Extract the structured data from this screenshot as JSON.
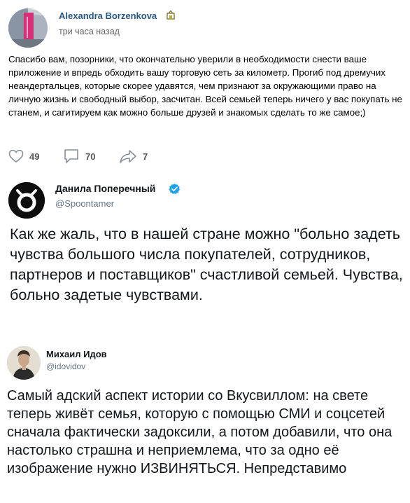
{
  "vk_post": {
    "author": "Alexandra Borzenkova",
    "time": "три часа назад",
    "text": "Спасибо вам, позорники, что окончательно уверили в необходимости снести ваше приложение и впредь обходить вашу торговую сеть за километр. Прогиб под дремучих неандертальцев, которые скорее удавятся, чем признают за окружающими право на личную жизнь и свободный выбор, засчитан. Всей семьей теперь ничего у вас покупать не станем, и сагитируем как можно больше друзей и знакомых сделать то же самое;)",
    "likes": "49",
    "comments": "70",
    "shares": "7",
    "link_color": "#2a5885"
  },
  "tweet1": {
    "name": "Данила Поперечный",
    "handle": "@Spoontamer",
    "verified": true,
    "text": "Как же жаль, что в нашей стране можно \"больно задеть чувства большого числа покупателей, сотрудников, партнеров и поставщиков\" счастливой семьей. Чувства, больно задетые чувствами."
  },
  "tweet2": {
    "name": "Михаил Идов",
    "handle": "@idovidov",
    "text": "Самый адский аспект истории со Вкусвиллом: на свете теперь живёт семья, которую с помощью СМИ и соцсетей сначала фактически задоксили, а потом добавили, что она настолько страшна и неприемлема, что за одно её изображение нужно ИЗВИНЯТЬСЯ. Непредставимо"
  },
  "icons": {
    "like": "heart-outline-icon",
    "comment": "speech-bubble-icon",
    "share": "share-arrow-icon",
    "verified": "verified-check-icon"
  }
}
